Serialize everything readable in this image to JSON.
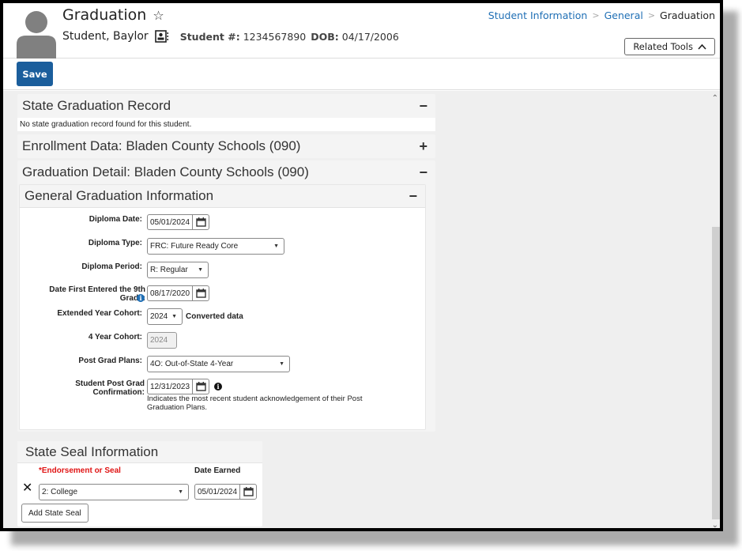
{
  "header": {
    "title": "Graduation",
    "student_name": "Student, Baylor",
    "student_number_label": "Student #:",
    "student_number": "1234567890",
    "dob_label": "DOB:",
    "dob": "04/17/2006",
    "breadcrumb": [
      "Student Information",
      "General",
      "Graduation"
    ],
    "related_tools_label": "Related Tools"
  },
  "toolbar": {
    "save_label": "Save"
  },
  "sections": {
    "state_graduation_record": {
      "title": "State Graduation Record",
      "toggle": "−",
      "message": "No state graduation record found for this student."
    },
    "enrollment_data": {
      "title": "Enrollment Data: Bladen County Schools (090)",
      "toggle": "+"
    },
    "graduation_detail": {
      "title": "Graduation Detail: Bladen County Schools (090)",
      "toggle": "−"
    },
    "general_info": {
      "title": "General Graduation Information",
      "toggle": "−",
      "fields": {
        "diploma_date": {
          "label": "Diploma Date:",
          "value": "05/01/2024"
        },
        "diploma_type": {
          "label": "Diploma Type:",
          "value": "FRC: Future Ready Core"
        },
        "diploma_period": {
          "label": "Diploma Period:",
          "value": "R: Regular"
        },
        "date_first_9th": {
          "label_line1": "Date First Entered the 9th",
          "label_line2": "Grade:",
          "value": "08/17/2020"
        },
        "extended_cohort": {
          "label": "Extended Year Cohort:",
          "value": "2024",
          "note": "Converted data"
        },
        "four_year_cohort": {
          "label": "4 Year Cohort:",
          "value": "2024"
        },
        "post_grad_plans": {
          "label": "Post Grad Plans:",
          "value": "4O: Out-of-State 4-Year"
        },
        "post_grad_confirmation": {
          "label_line1": "Student Post Grad",
          "label_line2": "Confirmation:",
          "value": "12/31/2023",
          "help": "Indicates the most recent student acknowledgement of their Post Graduation Plans."
        }
      }
    },
    "state_seal": {
      "title": "State Seal Information",
      "col_endorsement": "*Endorsement or Seal",
      "col_date_earned": "Date Earned",
      "rows": [
        {
          "endorsement": "2: College",
          "date_earned": "05/01/2024"
        }
      ],
      "add_label": "Add State Seal"
    }
  },
  "colors": {
    "accent": "#1b5e9c",
    "link": "#1f6fb5",
    "required": "#e01414"
  }
}
